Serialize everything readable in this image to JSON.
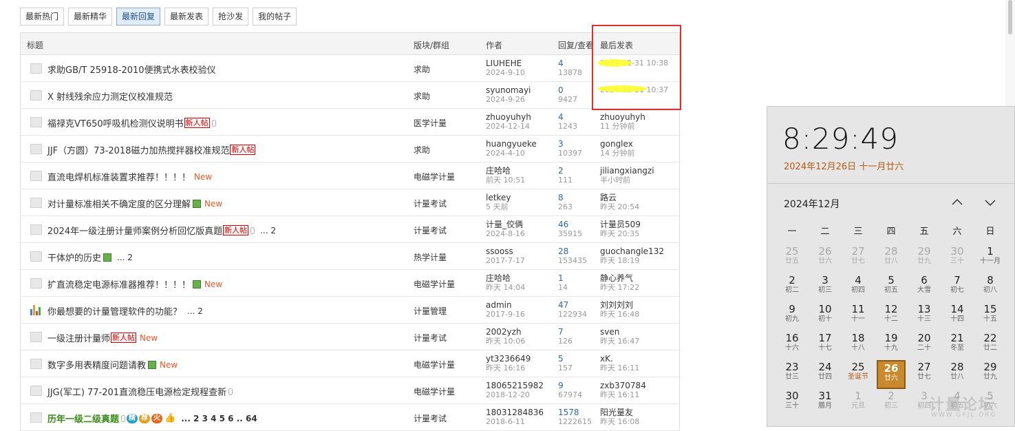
{
  "tabs": [
    {
      "label": "最新热门"
    },
    {
      "label": "最新精华"
    },
    {
      "label": "最新回复"
    },
    {
      "label": "最新发表"
    },
    {
      "label": "抢沙发"
    },
    {
      "label": "我的帖子"
    }
  ],
  "table_header": {
    "title": "标题",
    "board": "版块/群组",
    "author": "作者",
    "counts": "回复/查看",
    "last": "最后发表"
  },
  "rows": [
    {
      "title": "求助GB/T 25918-2010便携式水表校验仪",
      "board": "求助",
      "author": "LIUHEHE",
      "author_date": "2024-9-10",
      "replies": "4",
      "views": "13878",
      "last_user": "",
      "last_time": "2024-12-31 10:38"
    },
    {
      "title": "X 射线残余应力测定仪校准规范",
      "board": "求助",
      "author": "syunomayi",
      "author_date": "2024-9-26",
      "replies": "0",
      "views": "9427",
      "last_user": "",
      "last_time": "2024-12-31 10:37"
    },
    {
      "title": "福禄克VT650呼吸机检测仪说明书",
      "tag": "新人帖",
      "board": "医学计量",
      "author": "zhuoyuhyh",
      "author_date": "2024-12-14",
      "replies": "4",
      "views": "1243",
      "last_user": "zhuoyuhyh",
      "last_time": "11 分钟前"
    },
    {
      "title": "JJF（方圆）73-2018磁力加热搅拌器校准规范",
      "tag": "新人帖",
      "board": "求助",
      "author": "huangyueke",
      "author_date": "2024-4-10",
      "replies": "3",
      "views": "10397",
      "last_user": "gonglex",
      "last_time": "14 分钟前"
    },
    {
      "title": "直流电焊机标准装置求推荐！！！！",
      "new": "New",
      "board": "电磁学计量",
      "author": "庄哈哈",
      "author_date": "前天 10:51",
      "replies": "2",
      "views": "111",
      "last_user": "jiliangxiangzi",
      "last_time": "半小时前"
    },
    {
      "title": "对计量标准相关不确定度的区分理解",
      "new": "New",
      "board": "计量考试",
      "author": "letkey",
      "author_date": "5 天前",
      "replies": "8",
      "views": "263",
      "last_user": "路云",
      "last_time": "昨天 20:54"
    },
    {
      "title": "2024年一级注册计量师案例分析回忆版真题",
      "tag": "新人帖",
      "pages": "... 2",
      "board": "计量考试",
      "author": "计量_佼俩",
      "author_date": "2024-8-16",
      "replies": "46",
      "views": "35915",
      "last_user": "计量员509",
      "last_time": "昨天 20:35"
    },
    {
      "title": "干体炉的历史",
      "pages": "... 2",
      "board": "热学计量",
      "author": "ssooss",
      "author_date": "2017-7-17",
      "replies": "28",
      "views": "153435",
      "last_user": "guochangle132",
      "last_time": "昨天 18:19"
    },
    {
      "title": "扩直流稳定电源标准器推荐！！！！",
      "new": "New",
      "board": "电磁学计量",
      "author": "庄哈哈",
      "author_date": "昨天 14:04",
      "replies": "1",
      "views": "14",
      "last_user": "静心养气",
      "last_time": "昨天 17:22"
    },
    {
      "title": "你最想要的计量管理软件的功能？",
      "pages": "... 2",
      "board": "计量管理",
      "author": "admin",
      "author_date": "2017-9-16",
      "replies": "47",
      "views": "122934",
      "last_user": "刘刘刘刘",
      "last_time": "昨天 16:48"
    },
    {
      "title": "一级注册计量师",
      "tag": "新人帖",
      "new": "New",
      "board": "计量考试",
      "author": "2002yzh",
      "author_date": "昨天 10:06",
      "replies": "7",
      "views": "126",
      "last_user": "sven",
      "last_time": "昨天 16:47"
    },
    {
      "title": "数字多用表精度问题请教",
      "new": "New",
      "board": "电磁学计量",
      "author": "yt3236649",
      "author_date": "昨天 16:16",
      "replies": "5",
      "views": "157",
      "last_user": "xK.",
      "last_time": "昨天 16:11"
    },
    {
      "title": "JJG(军工) 77-201直流稳压电源检定规程查新",
      "board": "电磁学计量",
      "author": "18065215982",
      "author_date": "2018-12-20",
      "replies": "9",
      "views": "67974",
      "last_user": "zxb370784",
      "last_time": "昨天 16:11"
    },
    {
      "title": "历年一级二级真题",
      "badges": [
        "精",
        "荐",
        "火"
      ],
      "pages": "... 2 3 4 5 6 .. 64",
      "board": "计量考试",
      "author": "18031284836",
      "author_date": "2018-6-11",
      "replies": "1578",
      "views": "1222615",
      "last_user": "阳光量友",
      "last_time": "昨天 16:08"
    }
  ],
  "calendar": {
    "time": "8:29:49",
    "full_date": "2024年12月26日 十一月廿六",
    "month_label": "2024年12月",
    "weekdays": [
      "一",
      "二",
      "三",
      "四",
      "五",
      "六",
      "日"
    ],
    "days": [
      {
        "d": "25",
        "l": "廿五",
        "o": true
      },
      {
        "d": "26",
        "l": "廿六",
        "o": true
      },
      {
        "d": "27",
        "l": "廿七",
        "o": true
      },
      {
        "d": "28",
        "l": "廿八",
        "o": true
      },
      {
        "d": "29",
        "l": "廿九",
        "o": true
      },
      {
        "d": "30",
        "l": "三十",
        "o": true
      },
      {
        "d": "1",
        "l": "十一月"
      },
      {
        "d": "2",
        "l": "初二"
      },
      {
        "d": "3",
        "l": "初三"
      },
      {
        "d": "4",
        "l": "初四"
      },
      {
        "d": "5",
        "l": "初五"
      },
      {
        "d": "6",
        "l": "大雪"
      },
      {
        "d": "7",
        "l": "初七"
      },
      {
        "d": "8",
        "l": "初八"
      },
      {
        "d": "9",
        "l": "初九"
      },
      {
        "d": "10",
        "l": "初十"
      },
      {
        "d": "11",
        "l": "十一"
      },
      {
        "d": "12",
        "l": "十二"
      },
      {
        "d": "13",
        "l": "十三"
      },
      {
        "d": "14",
        "l": "十四"
      },
      {
        "d": "15",
        "l": "十五"
      },
      {
        "d": "16",
        "l": "十六"
      },
      {
        "d": "17",
        "l": "十七"
      },
      {
        "d": "18",
        "l": "十八"
      },
      {
        "d": "19",
        "l": "十九"
      },
      {
        "d": "20",
        "l": "二十"
      },
      {
        "d": "21",
        "l": "冬至"
      },
      {
        "d": "22",
        "l": "廿二"
      },
      {
        "d": "23",
        "l": "廿三"
      },
      {
        "d": "24",
        "l": "廿四"
      },
      {
        "d": "25",
        "l": "圣诞节",
        "f": true
      },
      {
        "d": "26",
        "l": "廿六",
        "t": true
      },
      {
        "d": "27",
        "l": "廿七"
      },
      {
        "d": "28",
        "l": "廿八"
      },
      {
        "d": "29",
        "l": "廿九"
      },
      {
        "d": "30",
        "l": "三十"
      },
      {
        "d": "31",
        "l": "腊月"
      },
      {
        "d": "1",
        "l": "元旦",
        "o": true
      },
      {
        "d": "2",
        "l": "初三",
        "o": true
      },
      {
        "d": "3",
        "l": "初四",
        "o": true
      },
      {
        "d": "4",
        "l": "初五",
        "o": true
      },
      {
        "d": "5",
        "l": "初六",
        "o": true
      }
    ]
  },
  "watermark": {
    "main": "计量论坛",
    "sub": "WWW.GFJL.ORG"
  },
  "colors": {
    "accent": "#2f66a8",
    "highlight": "#d9302f",
    "today": "#c98a2e",
    "new": "#e05a2a"
  }
}
